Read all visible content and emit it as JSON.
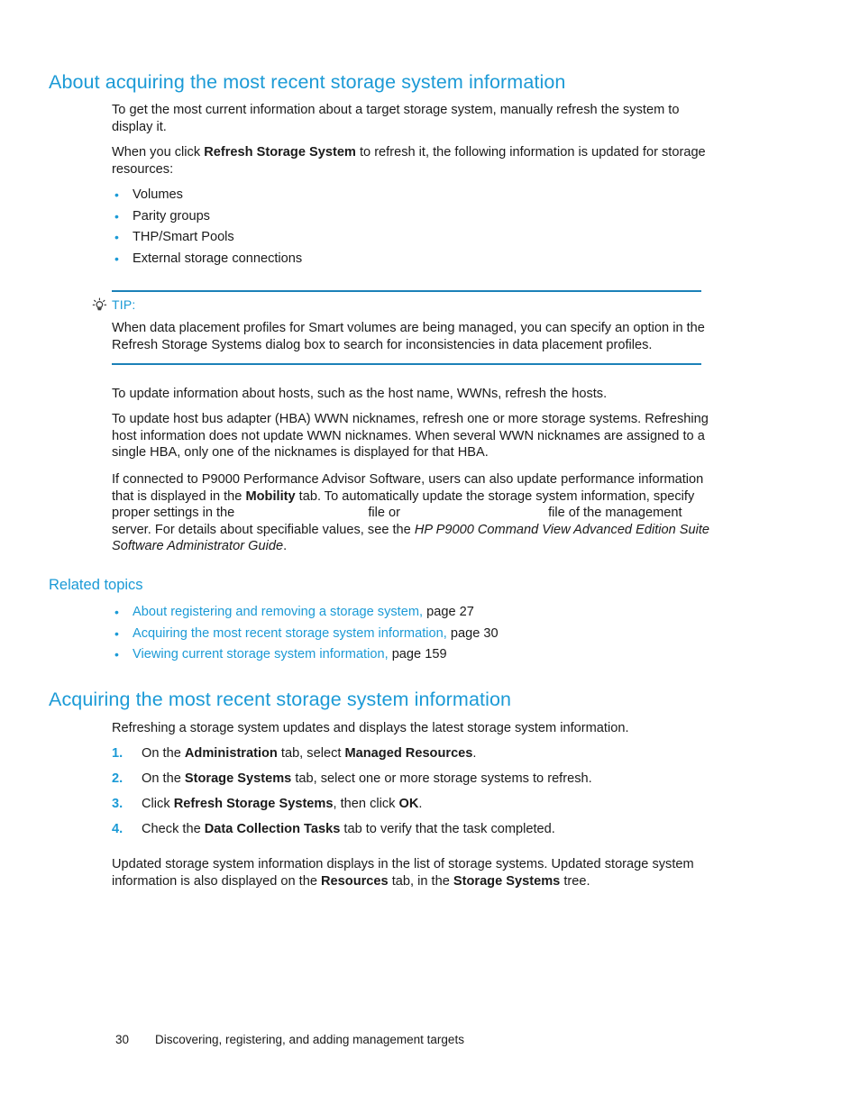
{
  "document": {
    "section1": {
      "heading": "About acquiring the most recent storage system information",
      "para1": "To get the most current information about a target storage system, manually refresh the system to display it.",
      "para2_part1": "When you click ",
      "para2_bold": "Refresh Storage System",
      "para2_part2": " to refresh it, the following information is updated for storage resources:",
      "bullets": [
        "Volumes",
        "Parity groups",
        "THP/Smart Pools",
        "External storage connections"
      ],
      "tip": {
        "icon": "lightbulb-icon",
        "label": "TIP:",
        "body": "When data placement profiles for Smart volumes are being managed, you can specify an option in the Refresh Storage Systems dialog box to search for inconsistencies in data placement profiles."
      },
      "para3": "To update information about hosts, such as the host name, WWNs, refresh the hosts.",
      "para4": "To update host bus adapter (HBA) WWN nicknames, refresh one or more storage systems. Refreshing host information does not update WWN nicknames. When several WWN nicknames are assigned to a single HBA, only one of the nicknames is displayed for that HBA.",
      "para5_part1": "If connected to P9000 Performance Advisor Software, users can also update performance information that is displayed in the ",
      "para5_bold1": "Mobility",
      "para5_part2": " tab. To automatically update the storage system information, specify proper settings in the ",
      "para5_part3": "file or ",
      "para5_part4": "file of the management server. For details about specifiable values, see the ",
      "para5_italic": "HP P9000 Command View Advanced Edition Suite Software Administrator Guide",
      "para5_part5": "."
    },
    "related_topics": {
      "heading": "Related topics",
      "items": [
        {
          "link": "About registering and removing a storage system",
          "comma": ",",
          "page": " page 27"
        },
        {
          "link": "Acquiring the most recent storage system information",
          "comma": ",",
          "page": " page 30"
        },
        {
          "link": "Viewing current storage system information",
          "comma": ",",
          "page": " page 159"
        }
      ]
    },
    "section2": {
      "heading": "Acquiring the most recent storage system information",
      "intro": "Refreshing a storage system updates and displays the latest storage system information.",
      "steps": [
        {
          "num": "1.",
          "part1": "On the ",
          "bold1": "Administration",
          "part2": " tab, select ",
          "bold2": "Managed Resources",
          "part3": "."
        },
        {
          "num": "2.",
          "part1": "On the ",
          "bold1": "Storage Systems",
          "part2": " tab, select one or more storage systems to refresh.",
          "bold2": "",
          "part3": ""
        },
        {
          "num": "3.",
          "part1": "Click ",
          "bold1": "Refresh Storage Systems",
          "part2": ", then click ",
          "bold2": "OK",
          "part3": "."
        },
        {
          "num": "4.",
          "part1": "Check the ",
          "bold1": "Data Collection Tasks",
          "part2": " tab to verify that the task completed.",
          "bold2": "",
          "part3": ""
        }
      ],
      "closing_part1": "Updated storage system information displays in the list of storage systems. Updated storage system information is also displayed on the ",
      "closing_bold1": "Resources",
      "closing_part2": " tab, in the ",
      "closing_bold2": "Storage Systems",
      "closing_part3": " tree."
    },
    "footer": {
      "page_number": "30",
      "chapter": "Discovering, registering, and adding management targets"
    },
    "colors": {
      "heading_blue": "#1b9ad6",
      "rule_blue": "#1b81b8",
      "body_black": "#1a1a1a"
    }
  }
}
